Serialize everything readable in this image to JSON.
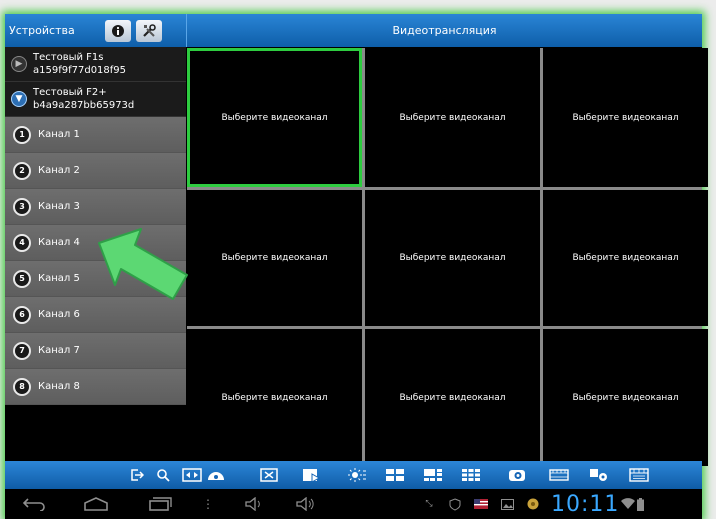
{
  "header": {
    "devices_title": "Устройства",
    "info_icon": "info-icon",
    "settings_icon": "tools-icon",
    "center_title": "Видеотрансляция"
  },
  "devices": [
    {
      "name": "Тестовый F1s",
      "id": "a159f9f77d018f95",
      "state": "collapsed"
    },
    {
      "name": "Тестовый F2+",
      "id": "b4a9a287bb65973d",
      "state": "expanded"
    }
  ],
  "channels": [
    {
      "num": "1",
      "label": "Канал 1"
    },
    {
      "num": "2",
      "label": "Канал 2"
    },
    {
      "num": "3",
      "label": "Канал 3"
    },
    {
      "num": "4",
      "label": "Канал 4"
    },
    {
      "num": "5",
      "label": "Канал 5"
    },
    {
      "num": "6",
      "label": "Канал 6"
    },
    {
      "num": "7",
      "label": "Канал 7"
    },
    {
      "num": "8",
      "label": "Канал 8"
    }
  ],
  "grid": {
    "cells": [
      "Выберите видеоканал",
      "Выберите видеоканал",
      "Выберите видеоканал",
      "Выберите видеоканал",
      "Выберите видеоканал",
      "Выберите видеоканал",
      "Выберите видеоканал",
      "Выберите видеоканал",
      "Выберите видеоканал"
    ],
    "selected_index": 0
  },
  "toolbar": {
    "icons": [
      "logout-icon",
      "search-icon",
      "fullscreen-icon",
      "ptz-icon",
      "snapshot-icon",
      "record-icon",
      "light-icon",
      "layout-4-icon",
      "layout-6-icon",
      "layout-9-icon",
      "camera-icon",
      "playback-icon",
      "photo-icon",
      "video-list-icon"
    ]
  },
  "system_bar": {
    "time": "10:11",
    "icons": [
      "back-icon",
      "home-icon",
      "recent-apps-icon",
      "menu-icon",
      "volume-down-icon",
      "volume-up-icon"
    ],
    "status_icons": [
      "fullscreen-status-icon",
      "shield-icon",
      "flag-icon",
      "gallery-icon",
      "app-icon",
      "wifi-icon",
      "battery-icon"
    ]
  },
  "colors": {
    "accent_blue": "#1a6fc0",
    "selected_green": "#2ecc40",
    "arrow_green": "#56d86a",
    "clock_blue": "#3aa8ff"
  }
}
